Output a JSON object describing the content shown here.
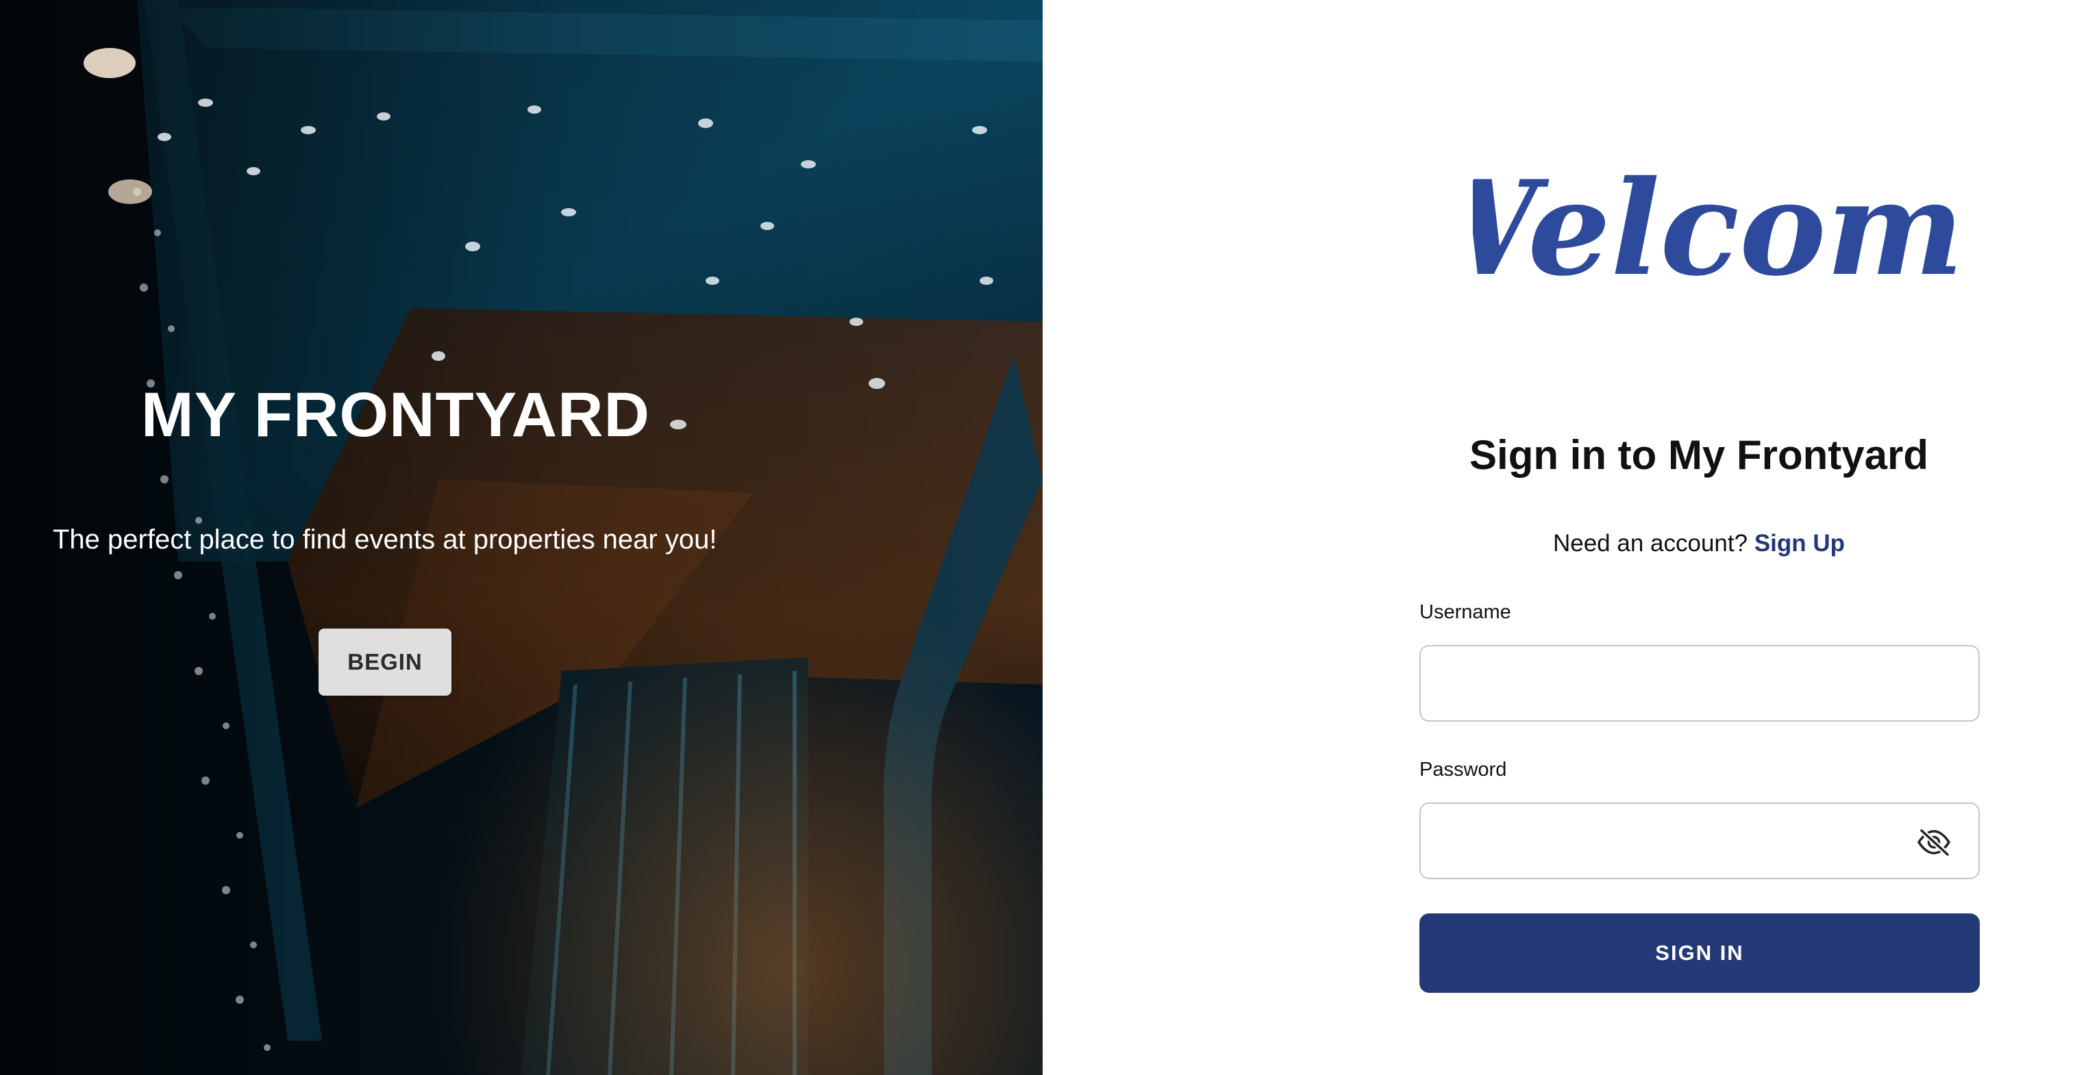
{
  "colors": {
    "brand_navy": "#233876",
    "welcome_blue": "#2d4a9c",
    "hero_overlay": "#05121c",
    "begin_button_bg": "#eeeeee"
  },
  "hero": {
    "title": "MY FRONTYARD",
    "tagline": "The perfect place to find events at properties near you!",
    "begin_label": "BEGIN"
  },
  "signin": {
    "welcome_logo_text": "Welcome",
    "heading": "Sign in to My Frontyard",
    "account_prompt": "Need an account?",
    "signup_label": "Sign Up",
    "username": {
      "label": "Username",
      "value": "",
      "placeholder": ""
    },
    "password": {
      "label": "Password",
      "value": "",
      "placeholder": "",
      "toggle_icon": "eye-slash-icon"
    },
    "submit_label": "SIGN IN"
  }
}
